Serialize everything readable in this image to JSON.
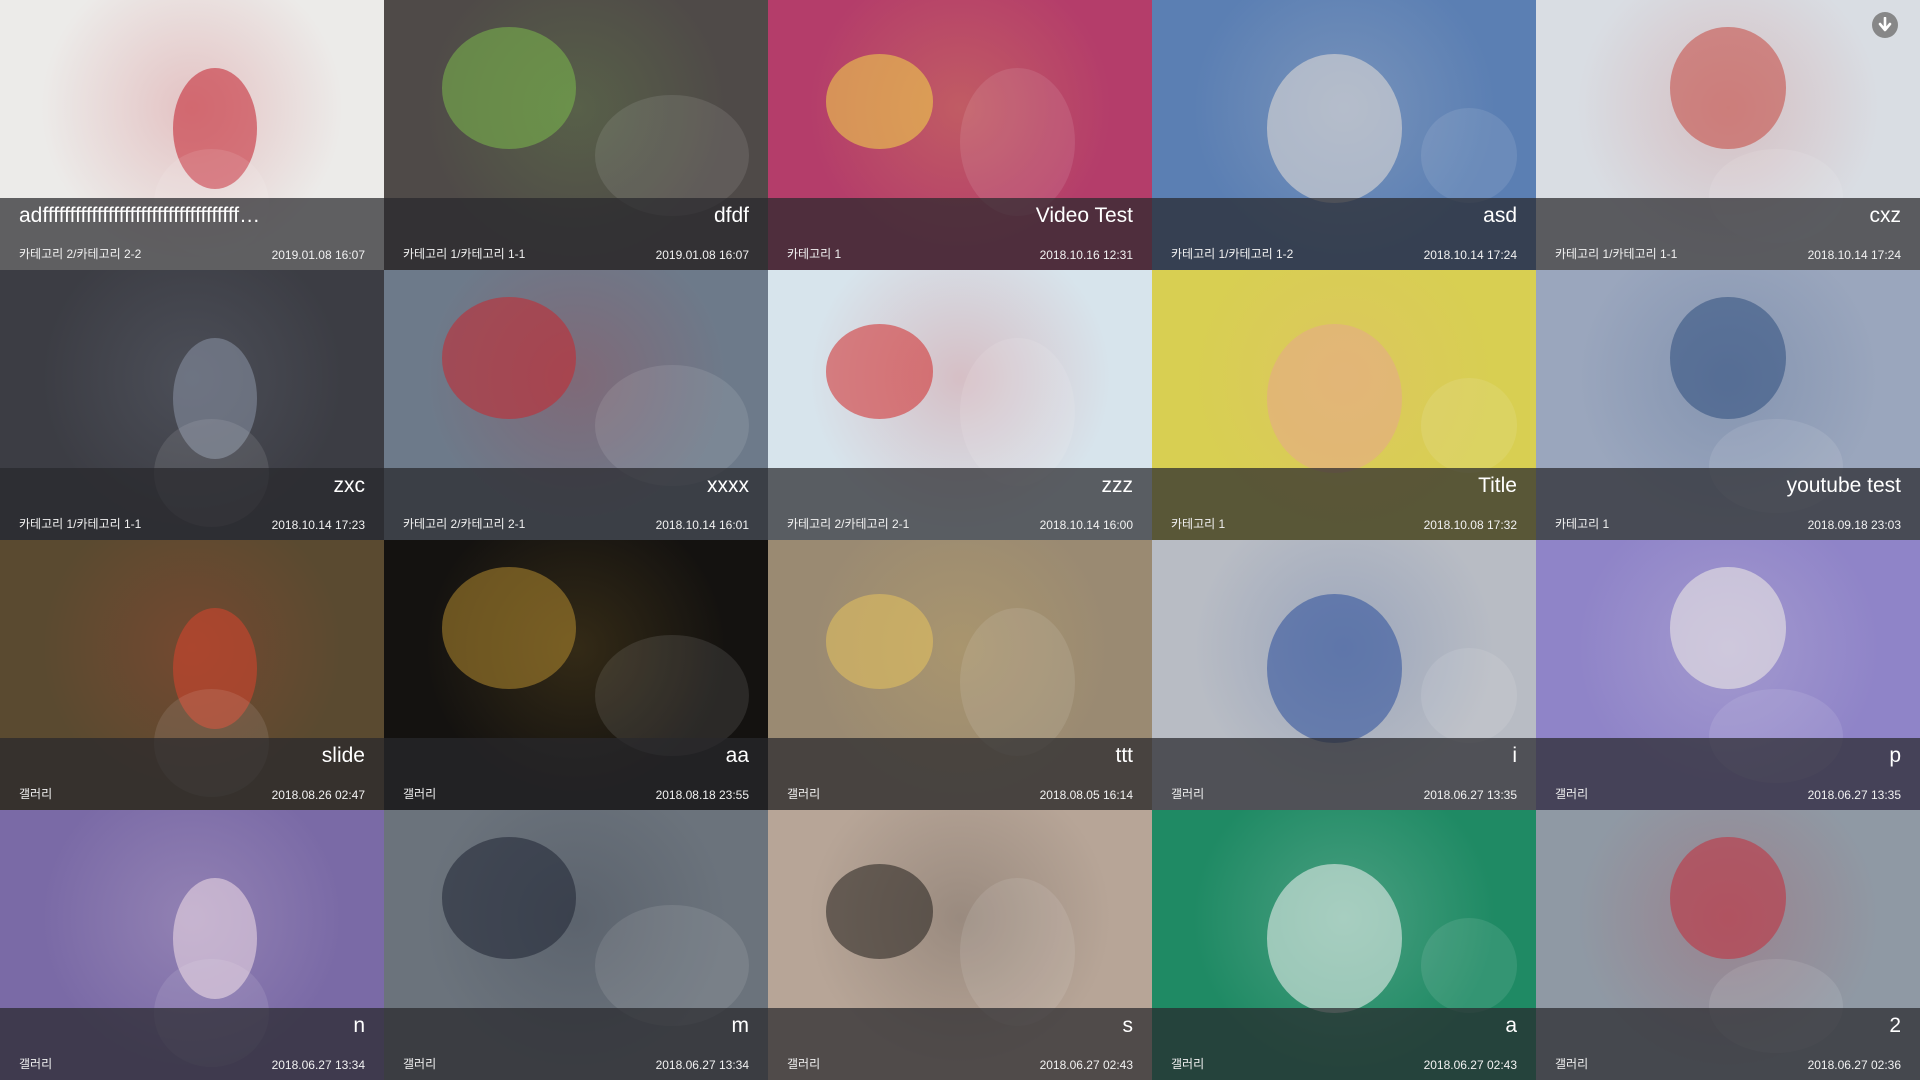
{
  "download_icon": "arrow-down-circle-icon",
  "tiles": [
    {
      "title": "adffffffffffffffffffffffffffffffffffff…",
      "title_align": "left",
      "category": "카테고리 2/카테고리 2-2",
      "date": "2019.01.08 16:07",
      "bg": "#ecebe9",
      "accent": "#c21f2b"
    },
    {
      "title": "dfdf",
      "title_align": "right",
      "category": "카테고리 1/카테고리 1-1",
      "date": "2019.01.08 16:07",
      "bg": "#4f4a48",
      "accent": "#7bb94c"
    },
    {
      "title": "Video Test",
      "title_align": "right",
      "category": "카테고리 1",
      "date": "2018.10.16 12:31",
      "bg": "#b43d6a",
      "accent": "#f3d74a"
    },
    {
      "title": "asd",
      "title_align": "right",
      "category": "카테고리 1/카테고리 1-2",
      "date": "2018.10.14 17:24",
      "bg": "#5b7fb3",
      "accent": "#e8e0d8"
    },
    {
      "title": "cxz",
      "title_align": "right",
      "category": "카테고리 1/카테고리 1-1",
      "date": "2018.10.14 17:24",
      "bg": "#d9dde3",
      "accent": "#c5473f"
    },
    {
      "title": "zxc",
      "title_align": "right",
      "category": "카테고리 1/카테고리 1-1",
      "date": "2018.10.14 17:23",
      "bg": "#3c3d44",
      "accent": "#8a93a6"
    },
    {
      "title": "xxxx",
      "title_align": "right",
      "category": "카테고리 2/카테고리 2-1",
      "date": "2018.10.14 16:01",
      "bg": "#6d7a8a",
      "accent": "#c8262e"
    },
    {
      "title": "zzz",
      "title_align": "right",
      "category": "카테고리 2/카테고리 2-1",
      "date": "2018.10.14 16:00",
      "bg": "#d7e4ec",
      "accent": "#d22a2a"
    },
    {
      "title": "Title",
      "title_align": "right",
      "category": "카테고리 1",
      "date": "2018.10.08 17:32",
      "bg": "#d8cf52",
      "accent": "#e8a88d"
    },
    {
      "title": "youtube test",
      "title_align": "right",
      "category": "카테고리 1",
      "date": "2018.09.18 23:03",
      "bg": "#9aa6bd",
      "accent": "#2f4e7e"
    },
    {
      "title": "slide",
      "title_align": "right",
      "category": "갤러리",
      "date": "2018.08.26 02:47",
      "bg": "#5a4a30",
      "accent": "#d9432e"
    },
    {
      "title": "aa",
      "title_align": "right",
      "category": "갤러리",
      "date": "2018.08.18 23:55",
      "bg": "#141210",
      "accent": "#b28b2f"
    },
    {
      "title": "ttt",
      "title_align": "right",
      "category": "갤러리",
      "date": "2018.08.05 16:14",
      "bg": "#9a8a72",
      "accent": "#e5c25e"
    },
    {
      "title": "i",
      "title_align": "right",
      "category": "갤러리",
      "date": "2018.06.27 13:35",
      "bg": "#b8bcc4",
      "accent": "#2c4f9a"
    },
    {
      "title": "p",
      "title_align": "right",
      "category": "갤러리",
      "date": "2018.06.27 13:35",
      "bg": "#8f84c8",
      "accent": "#f2efe8"
    },
    {
      "title": "n",
      "title_align": "right",
      "category": "갤러리",
      "date": "2018.06.27 13:34",
      "bg": "#7a6aa6",
      "accent": "#f2dfe8"
    },
    {
      "title": "m",
      "title_align": "right",
      "category": "갤러리",
      "date": "2018.06.27 13:34",
      "bg": "#6b737c",
      "accent": "#1f2433"
    },
    {
      "title": "s",
      "title_align": "right",
      "category": "갤러리",
      "date": "2018.06.27 02:43",
      "bg": "#b7a597",
      "accent": "#24201e"
    },
    {
      "title": "a",
      "title_align": "right",
      "category": "갤러리",
      "date": "2018.06.27 02:43",
      "bg": "#1f8a64",
      "accent": "#f4f4f4"
    },
    {
      "title": "2",
      "title_align": "right",
      "category": "갤러리",
      "date": "2018.06.27 02:36",
      "bg": "#8f99a4",
      "accent": "#c22b3a"
    }
  ]
}
